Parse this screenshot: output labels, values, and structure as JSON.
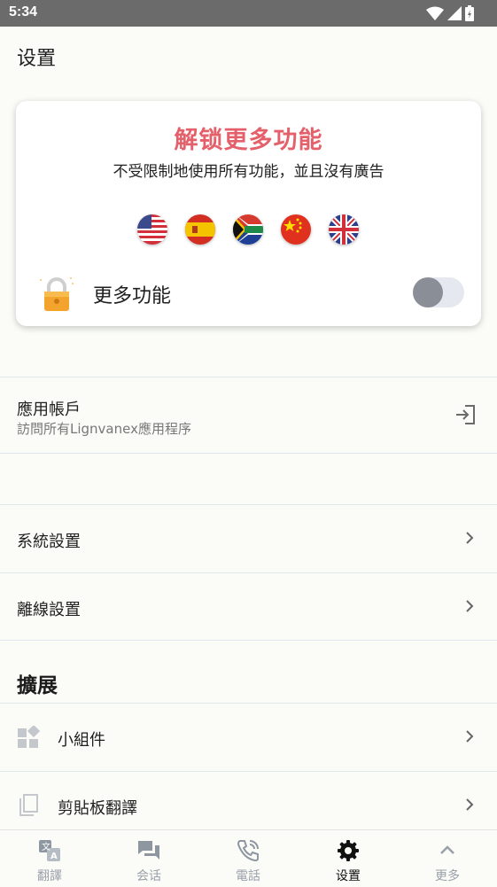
{
  "status": {
    "time": "5:34"
  },
  "header": {
    "title": "设置"
  },
  "promo": {
    "title": "解锁更多功能",
    "subtitle": "不受限制地使用所有功能，並且沒有廣告",
    "flags": [
      "us-flag-icon",
      "es-flag-icon",
      "za-flag-icon",
      "cn-flag-icon",
      "gb-flag-icon"
    ],
    "feature_label": "更多功能",
    "toggle_on": false
  },
  "account": {
    "title": "應用帳戶",
    "subtitle": "訪問所有Lignvanex應用程序"
  },
  "settings_rows": [
    {
      "label": "系統設置"
    },
    {
      "label": "離線設置"
    }
  ],
  "extensions": {
    "title": "擴展",
    "items": [
      {
        "label": "小組件",
        "icon": "widgets-icon"
      },
      {
        "label": "剪貼板翻譯",
        "icon": "copy-icon"
      }
    ]
  },
  "bottom_nav": [
    {
      "label": "翻譯",
      "icon": "translate-icon",
      "active": false
    },
    {
      "label": "会话",
      "icon": "chat-icon",
      "active": false
    },
    {
      "label": "電話",
      "icon": "phone-icon",
      "active": false
    },
    {
      "label": "设置",
      "icon": "gear-icon",
      "active": true
    },
    {
      "label": "更多",
      "icon": "chevron-up-icon",
      "active": false
    }
  ],
  "colors": {
    "accent": "#e4606a",
    "status_bar": "#6b6b6b",
    "inactive": "#9aa0a8"
  }
}
